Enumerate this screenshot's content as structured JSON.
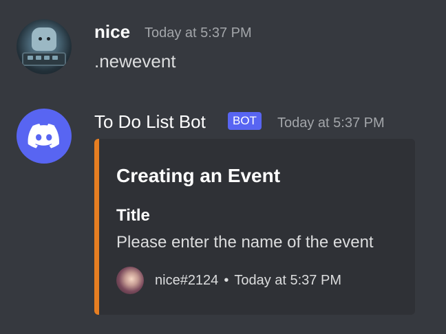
{
  "messages": [
    {
      "username": "nice",
      "timestamp": "Today at 5:37 PM",
      "content": ".newevent"
    },
    {
      "username": "To Do List Bot",
      "tag": "BOT",
      "timestamp": "Today at 5:37 PM",
      "embed": {
        "accent_color": "#e67e22",
        "title": "Creating an Event",
        "field_name": "Title",
        "field_value": "Please enter the name of the event",
        "footer_text": "nice#2124",
        "footer_separator": "•",
        "footer_timestamp": "Today at 5:37 PM"
      }
    }
  ],
  "icons": {
    "bot_avatar": "discord-logo-icon",
    "user_avatar": "user-avatar-photo",
    "footer_avatar": "footer-avatar-photo"
  },
  "colors": {
    "background": "#36393f",
    "embed_background": "#2f3136",
    "blurple": "#5865f2",
    "timestamp": "#a3a6aa"
  }
}
